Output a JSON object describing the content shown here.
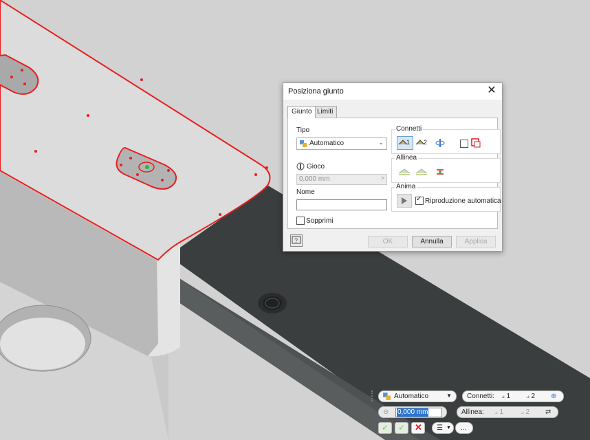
{
  "dialog": {
    "title": "Posiziona giunto",
    "tabs": [
      "Giunto",
      "Limiti"
    ],
    "tipo_label": "Tipo",
    "tipo_value": "Automatico",
    "gioco_label": "Gioco",
    "gioco_value": "0,000 mm",
    "nome_label": "Nome",
    "nome_value": "",
    "sopprimi_label": "Sopprimi",
    "connetti_label": "Connetti",
    "connetti_1": "1",
    "connetti_2": "2",
    "allinea_label": "Allinea",
    "anima_label": "Anima",
    "riproduzione_label": "Riproduzione automatica",
    "buttons": {
      "ok": "OK",
      "annulla": "Annulla",
      "applica": "Applica"
    }
  },
  "minitoolbar": {
    "tipo_value": "Automatico",
    "connetti_label": "Connetti:",
    "connetti_1": "1",
    "connetti_2": "2",
    "gioco_value": "0,000 mm",
    "allinea_label": "Allinea:",
    "allinea_1": "1",
    "allinea_2": "2",
    "more_label": "..."
  },
  "colors": {
    "selection_red": "#e81e1e",
    "highlight_blue": "#2a76d2",
    "cancel_red": "#d21f1f",
    "ok_green": "#7fbf6a"
  }
}
